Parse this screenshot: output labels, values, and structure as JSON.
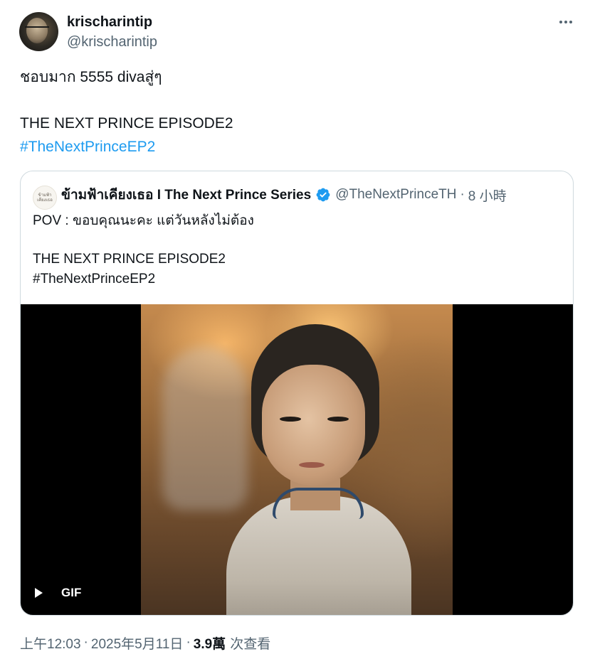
{
  "author": {
    "display_name": "krischarintip",
    "handle": "@krischarintip"
  },
  "tweet": {
    "text_line1": "ชอบมาก 5555 divaสู่ๆ",
    "text_line2": "THE NEXT PRINCE EPISODE2",
    "hashtag": "#TheNextPrinceEP2"
  },
  "quote": {
    "avatar_logo_text": "ข้ามฟ้า เคียงเธอ",
    "display_name": "ข้ามฟ้าเคียงเธอ I The Next Prince Series",
    "handle": "@TheNextPrinceTH",
    "separator": "·",
    "time_ago": "8 小時",
    "text_line1": "POV : ขอบคุณนะคะ แต่วันหลังไม่ต้อง",
    "text_line2": "THE NEXT PRINCE EPISODE2",
    "hashtag": "#TheNextPrinceEP2",
    "media": {
      "type": "GIF",
      "badge_label": "GIF"
    }
  },
  "meta": {
    "time": "上午12:03",
    "separator": "·",
    "date": "2025年5月11日",
    "views_count": "3.9萬",
    "views_label": "次查看"
  },
  "colors": {
    "link": "#1d9bf0",
    "secondary_text": "#536471",
    "verified": "#1d9bf0",
    "border": "#cfd9de"
  },
  "icons": {
    "more": "more-horizontal-icon",
    "verified": "verified-badge-icon",
    "play": "play-icon"
  }
}
